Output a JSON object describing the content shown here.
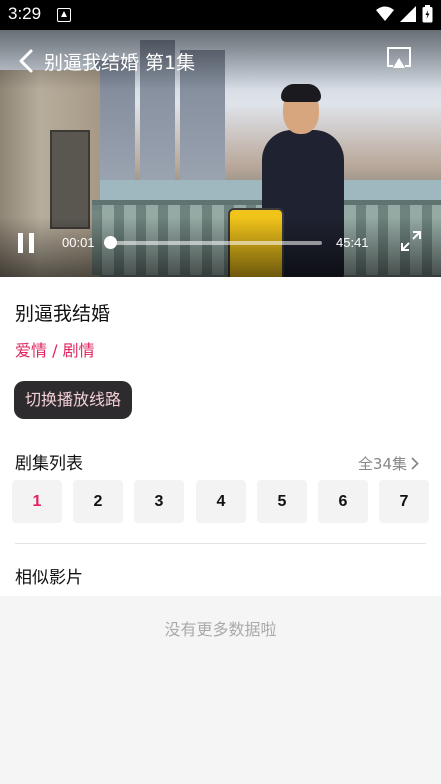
{
  "status_bar": {
    "time": "3:29"
  },
  "player": {
    "title": "别逼我结婚 第1集",
    "current_time": "00:01",
    "total_time": "45:41",
    "progress": 0.0004
  },
  "show": {
    "title": "别逼我结婚",
    "genres": "爱情 / 剧情",
    "switch_line_label": "切换播放线路"
  },
  "episodes": {
    "section_title": "剧集列表",
    "total_label": "全34集",
    "items": [
      "1",
      "2",
      "3",
      "4",
      "5",
      "6",
      "7"
    ],
    "active_index": 0
  },
  "similar": {
    "section_title": "相似影片"
  },
  "footer": {
    "no_more_text": "没有更多数据啦"
  },
  "colors": {
    "accent": "#e0245e",
    "button_bg": "#2d2b2e"
  }
}
